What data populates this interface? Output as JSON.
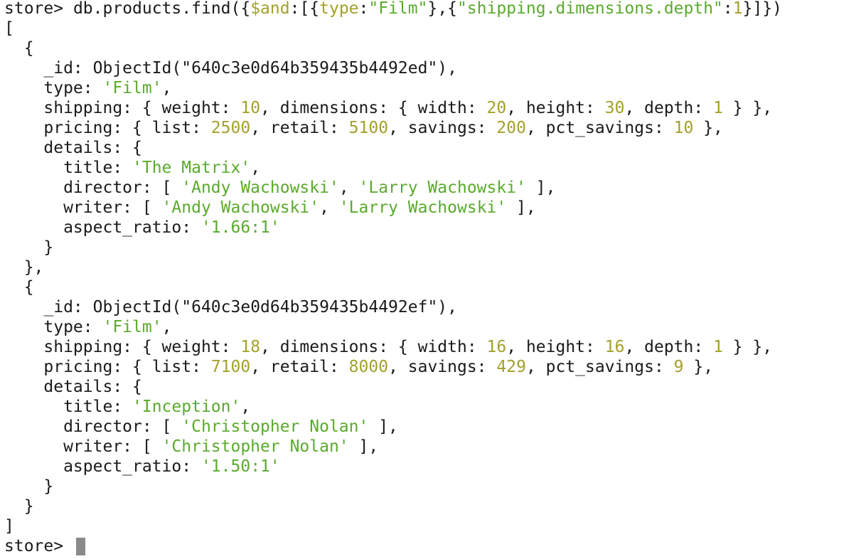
{
  "terminal": {
    "prompt": "store>",
    "command": {
      "pre": "db.products.find({",
      "op": "$and",
      "mid1": ":[{",
      "key1": "type",
      "colon1": ":",
      "val1": "\"Film\"",
      "mid2": "},{",
      "key2": "\"shipping.dimensions.depth\"",
      "colon2": ":",
      "val2": "1",
      "tail": "}]})"
    },
    "open_array": "[",
    "close_array": "]",
    "results": [
      {
        "id": "640c3e0d64b359435b4492ed",
        "type": "'Film'",
        "weight": "10",
        "width": "20",
        "height": "30",
        "depth": "1",
        "list": "2500",
        "retail": "5100",
        "savings": "200",
        "pct_savings": "10",
        "title": "'The Matrix'",
        "director1": "'Andy Wachowski'",
        "director2": "'Larry Wachowski'",
        "writer1": "'Andy Wachowski'",
        "writer2": "'Larry Wachowski'",
        "aspect_ratio": "'1.66:1'"
      },
      {
        "id": "640c3e0d64b359435b4492ef",
        "type": "'Film'",
        "weight": "18",
        "width": "16",
        "height": "16",
        "depth": "1",
        "list": "7100",
        "retail": "8000",
        "savings": "429",
        "pct_savings": "9",
        "title": "'Inception'",
        "director1": "'Christopher Nolan'",
        "writer1": "'Christopher Nolan'",
        "aspect_ratio": "'1.50:1'"
      }
    ]
  }
}
